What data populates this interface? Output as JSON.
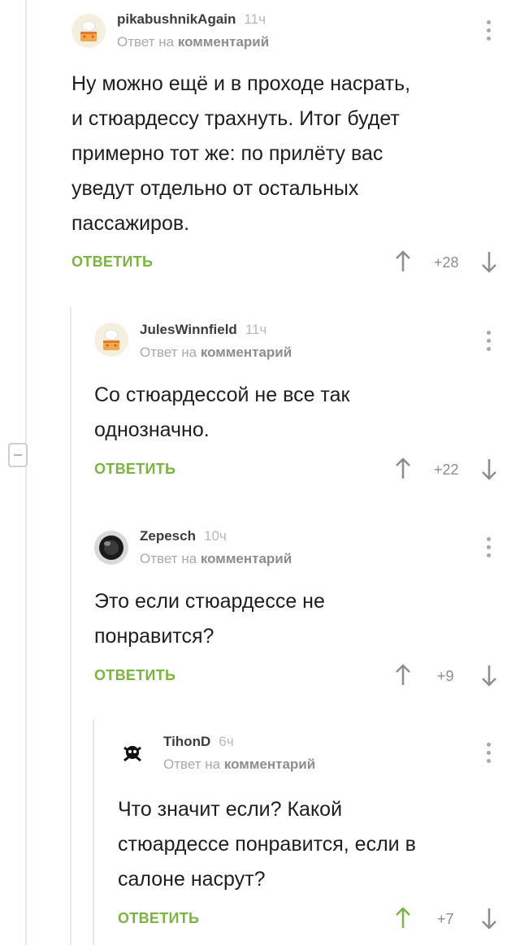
{
  "comments": [
    {
      "author": "pikabushnikAgain",
      "time": "11ч",
      "reply_prefix": "Ответ на",
      "reply_target": "комментарий",
      "text_lines": [
        "Ну можно ещё и в проходе насрать,",
        "и стюардессу трахнуть. Итог будет",
        "примерно тот же: по прилёту вас",
        "уведут отдельно от остальных",
        "пассажиров."
      ],
      "reply_label": "ОТВЕТИТЬ",
      "rating": "+28",
      "avatar_icon": "chef-cake-avatar-icon"
    },
    {
      "author": "JulesWinnfield",
      "time": "11ч",
      "reply_prefix": "Ответ на",
      "reply_target": "комментарий",
      "text_lines": [
        "Со стюардессой не все так",
        "однозначно."
      ],
      "reply_label": "ОТВЕТИТЬ",
      "rating": "+22",
      "avatar_icon": "chef-cake-avatar-icon"
    },
    {
      "author": "Zepesch",
      "time": "10ч",
      "reply_prefix": "Ответ на",
      "reply_target": "комментарий",
      "text_lines": [
        "Это если стюардессе не",
        "понравится?"
      ],
      "reply_label": "ОТВЕТИТЬ",
      "rating": "+9",
      "avatar_icon": "dark-photo-avatar-icon"
    },
    {
      "author": "TihonD",
      "time": "6ч",
      "reply_prefix": "Ответ на",
      "reply_target": "комментарий",
      "text_lines": [
        "Что значит если? Какой",
        "стюардессе понравится, если в",
        "салоне насрут?"
      ],
      "reply_label": "ОТВЕТИТЬ",
      "rating": "+7",
      "avatar_icon": "skull-crossbones-avatar-icon"
    }
  ],
  "colors": {
    "accent_green": "#7cb342",
    "upvoted_arrow": "#7cb342",
    "default_arrow": "#8d8d8d",
    "text": "#1e1e1e",
    "muted": "#a9a9a9"
  }
}
